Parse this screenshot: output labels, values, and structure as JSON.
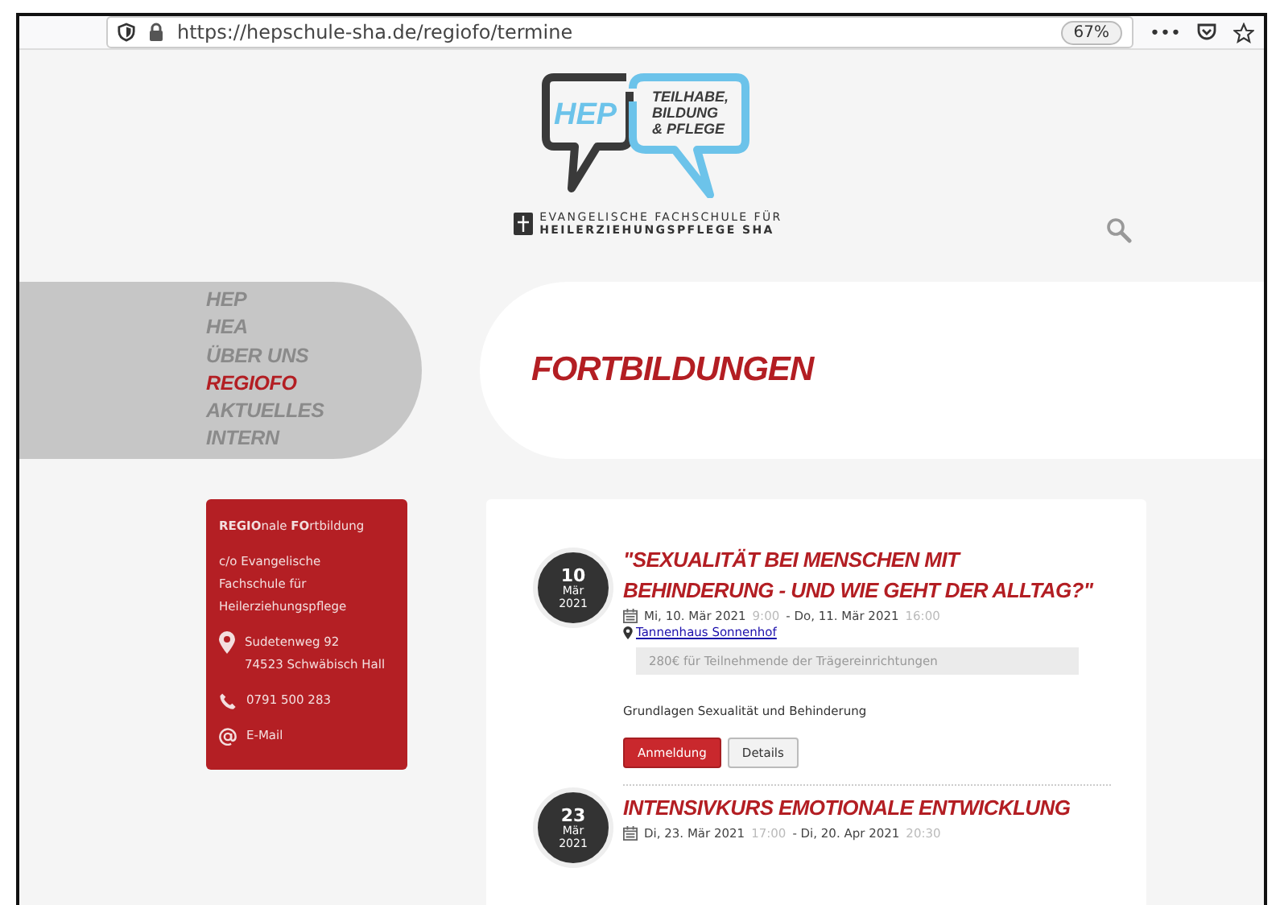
{
  "browser": {
    "url": "https://hepschule-sha.de/regiofo/termine",
    "zoom": "67%",
    "menu": "•••"
  },
  "logo": {
    "mark": "HEP",
    "slogan": [
      "TEILHABE,",
      "BILDUNG",
      "& PFLEGE"
    ],
    "school": [
      "EVANGELISCHE FACHSCHULE FÜR",
      "HEILERZIEHUNGSPFLEGE SHA"
    ]
  },
  "nav": [
    {
      "label": "HEP",
      "selected": false
    },
    {
      "label": "HEA",
      "selected": false
    },
    {
      "label": "ÜBER UNS",
      "selected": false
    },
    {
      "label": "REGIOFO",
      "selected": true
    },
    {
      "label": "AKTUELLES",
      "selected": false
    },
    {
      "label": "INTERN",
      "selected": false
    }
  ],
  "page_title": "FORTBILDUNGEN",
  "contact": {
    "heading": "**REGIO**nale **FO**rtbildung",
    "lines": [
      "c/o Evangelische",
      "Fachschule für",
      "Heilerziehungspflege"
    ],
    "address": [
      "Sudetenweg 92",
      "74523 Schwäbisch Hall"
    ],
    "phone": "0791 500 283",
    "email": "E-Mail"
  },
  "events": [
    {
      "day": "10",
      "month": "Mär",
      "year": "2021",
      "title": "\"SEXUALITÄT BEI MENSCHEN MIT BEHINDERUNG - UND WIE GEHT DER ALLTAG?\"",
      "start_date": "Mi, 10. Mär 2021",
      "start_time": "9:00",
      "end_date": "- Do, 11. Mär 2021",
      "end_time": "16:00",
      "location": "Tannenhaus Sonnenhof",
      "price": "280€ für Teilnehmende der Trägereinrichtungen",
      "description": "Grundlagen Sexualität und Behinderung",
      "buttons": [
        "Anmeldung",
        "Details"
      ]
    },
    {
      "day": "23",
      "month": "Mär",
      "year": "2021",
      "title": "INTENSIVKURS EMOTIONALE ENTWICKLUNG",
      "start_date": "Di, 23. Mär 2021",
      "start_time": "17:00",
      "end_date": "- Di, 20. Apr 2021",
      "end_time": "20:30"
    }
  ]
}
